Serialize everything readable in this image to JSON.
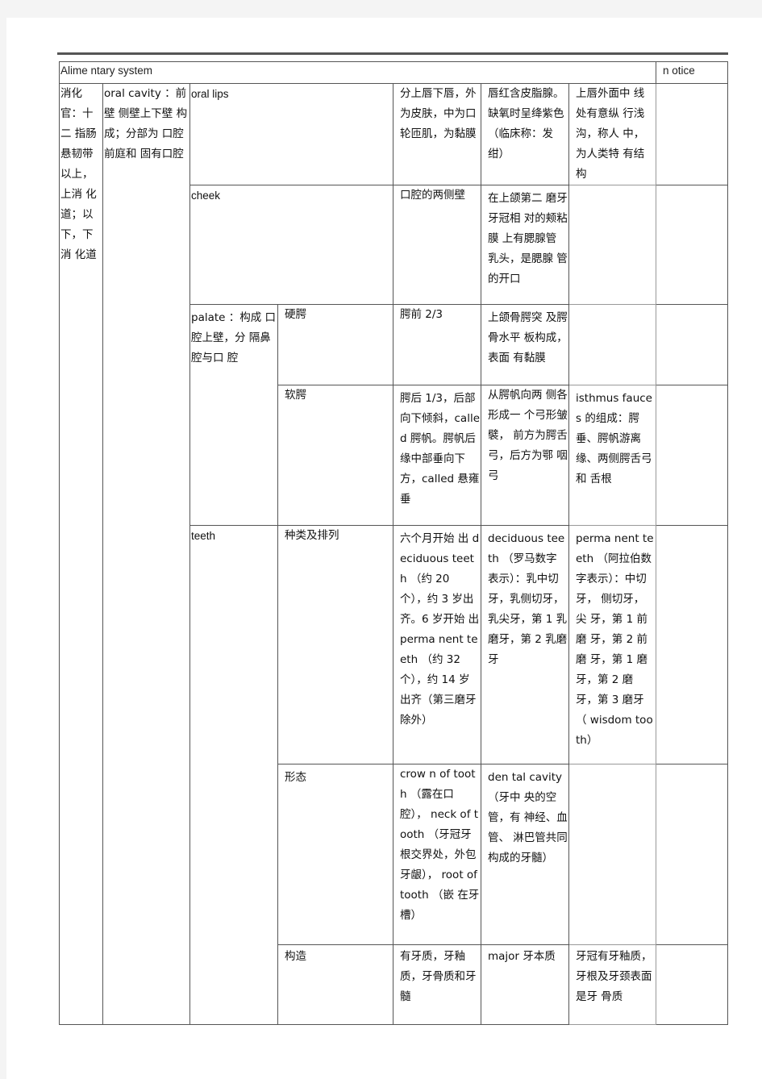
{
  "document": {
    "title_left": "Alime ntary system",
    "title_right": "n otice",
    "col1": "消化官：十二 指肠 悬韧带以上，上消 化道；以 下，下消 化道",
    "col2": "oral cavity ：前壁 侧壁上下壁 构成；分部为 口腔前庭和 固有口腔",
    "rows": [
      {
        "part": "oral lips",
        "sub": "",
        "c1": "分上唇下唇，外为皮肤，中为口轮匝肌，为黏膜",
        "c2": "唇红含皮脂腺。缺氧时呈绛紫色（临床称：发绀）",
        "c3": "上唇外面中 线处有意纵 行浅沟，称人 中，为人类特 有结构",
        "c4": ""
      },
      {
        "part": "cheek",
        "sub": "",
        "c1": "口腔的两侧壁",
        "c2": "在上颌第二 磨牙牙冠相 对的颊粘膜 上有腮腺管 乳头，是腮腺 管的开口",
        "c3": "",
        "c4": ""
      },
      {
        "part": "palate ：构成 口腔上壁，分 隔鼻腔与口 腔",
        "sub": "硬腭",
        "c1": "腭前 2/3",
        "c2": "上颌骨腭突 及腭骨水平 板构成，表面 有黏膜",
        "c3": "",
        "c4": ""
      },
      {
        "part": "",
        "sub": "软腭",
        "c1": "腭后 1/3，后部向下倾斜，called 腭帆。腭帆后缘中部垂向下方，called 悬雍垂",
        "c2": "从腭帆向两 侧各形成一 个弓形皱襞， 前方为腭舌 弓，后方为鄂 咽弓",
        "c3": "isthmus fauces 的组成：腭垂、腭帆游离缘、两侧腭舌弓和 舌根",
        "c4": ""
      },
      {
        "part": "teeth",
        "sub": "种类及排列",
        "c1": "六个月开始 出 deciduous teeth （约 20 个），约 3 岁出齐。6 岁开始 出 perma nent teeth （约 32 个），约 14 岁出齐（第三磨牙除外）",
        "c2": "deciduous teeth （罗马数字表示）：乳中切牙，乳侧切牙，乳尖牙，第 1 乳磨牙，第 2 乳磨牙",
        "c3": "perma nent teeth （阿拉伯数字表示）：中切牙， 侧切牙，尖 牙，第 1 前磨 牙，第 2 前磨 牙，第 1 磨牙，第 2 磨牙，第 3 磨牙 （ wisdom tooth）",
        "c4": ""
      },
      {
        "part": "",
        "sub": "形态",
        "c1": "crow n of tooth （露在口腔）， neck of tooth （牙冠牙根交界处，外包牙龈）， root of tooth （嵌 在牙槽）",
        "c2": "den tal cavity （牙中 央的空管，有 神经、血管、 淋巴管共同 构成的牙髓）",
        "c3": "",
        "c4": ""
      },
      {
        "part": "",
        "sub": "构造",
        "c1": "有牙质，牙釉质，牙骨质和牙髓",
        "c2": "major 牙本质",
        "c3": "牙冠有牙釉质，牙根及牙颈表面是牙 骨质",
        "c4": ""
      }
    ]
  }
}
